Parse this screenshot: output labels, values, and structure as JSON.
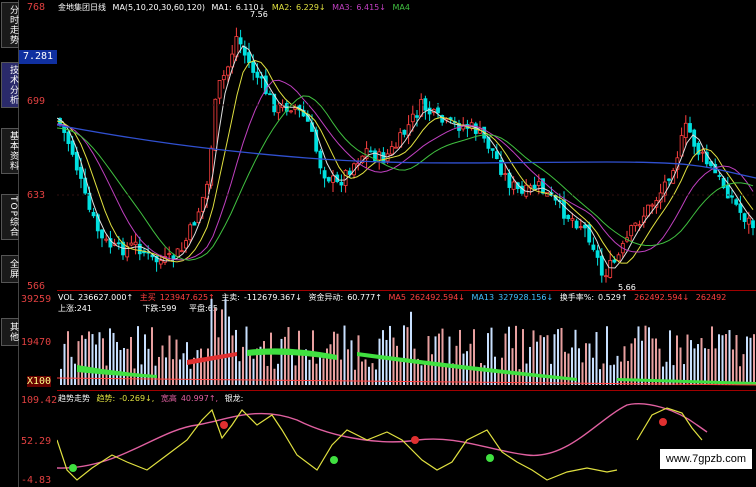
{
  "sidebar": {
    "tabs": [
      {
        "label": "分时走势"
      },
      {
        "label": "技术分析"
      },
      {
        "label": "基本资料"
      },
      {
        "label": "TOP综合"
      },
      {
        "label": "全屏"
      },
      {
        "label": "其他"
      }
    ]
  },
  "axis": {
    "price_top": "768",
    "current_price": "7.281",
    "price_699": "699",
    "price_633": "633",
    "price_566": "566",
    "vol_top": "39259",
    "vol_mid": "19470",
    "vol_unit": "X100",
    "trend_top": "109.42",
    "trend_mid": "52.29",
    "trend_bottom": "-4.83"
  },
  "header": {
    "title": "金地集团日线",
    "ma_params": "MA(5,10,20,30,60,120)",
    "ma1_label": "MA1:",
    "ma1_val": "6.110↓",
    "ma2_label": "MA2:",
    "ma2_val": "6.229↓",
    "ma3_label": "MA3:",
    "ma3_val": "6.415↓",
    "ma4_label": "MA4"
  },
  "price_annotations": {
    "high": "7.56",
    "low": "5.66"
  },
  "vol_header": {
    "vol_label": "VOL",
    "vol_val": "236627.000↑",
    "zhu_mai": "主买",
    "zhu_mai_val": "123947.625↑",
    "zhu_mai2": "主卖:",
    "zhu_mai2_val": "-112679.367↓",
    "zijin": "资金异动:",
    "zijin_val": "60.777↑",
    "ma5": "MA5",
    "ma5_val": "262492.594↓",
    "ma13": "MA13",
    "ma13_val": "327928.156↓",
    "huanshou": "换手率%:",
    "huanshou_val": "0.529↑",
    "extra1": "262492.594↓",
    "extra2": "262492",
    "up_count": "上涨:241",
    "down_count": "下跌:599",
    "flat_count": "平盘:65"
  },
  "trend_header": {
    "title": "趋势走势",
    "trend_label": "趋势:",
    "trend_val": "-0.269↓,",
    "kuan": "宽高",
    "kuan_val": "40.997↑,",
    "yinlong": "银龙:"
  },
  "watermark": "www.7gpzb.com",
  "colors": {
    "up": "#ff4040",
    "down": "#00e0e0",
    "ma_white": "#e0e0e0",
    "ma_yellow": "#e0e040",
    "ma_purple": "#c040c0",
    "ma_green": "#40c040",
    "ma_blue": "#3050d0",
    "ma_pink": "#e060a0"
  }
}
